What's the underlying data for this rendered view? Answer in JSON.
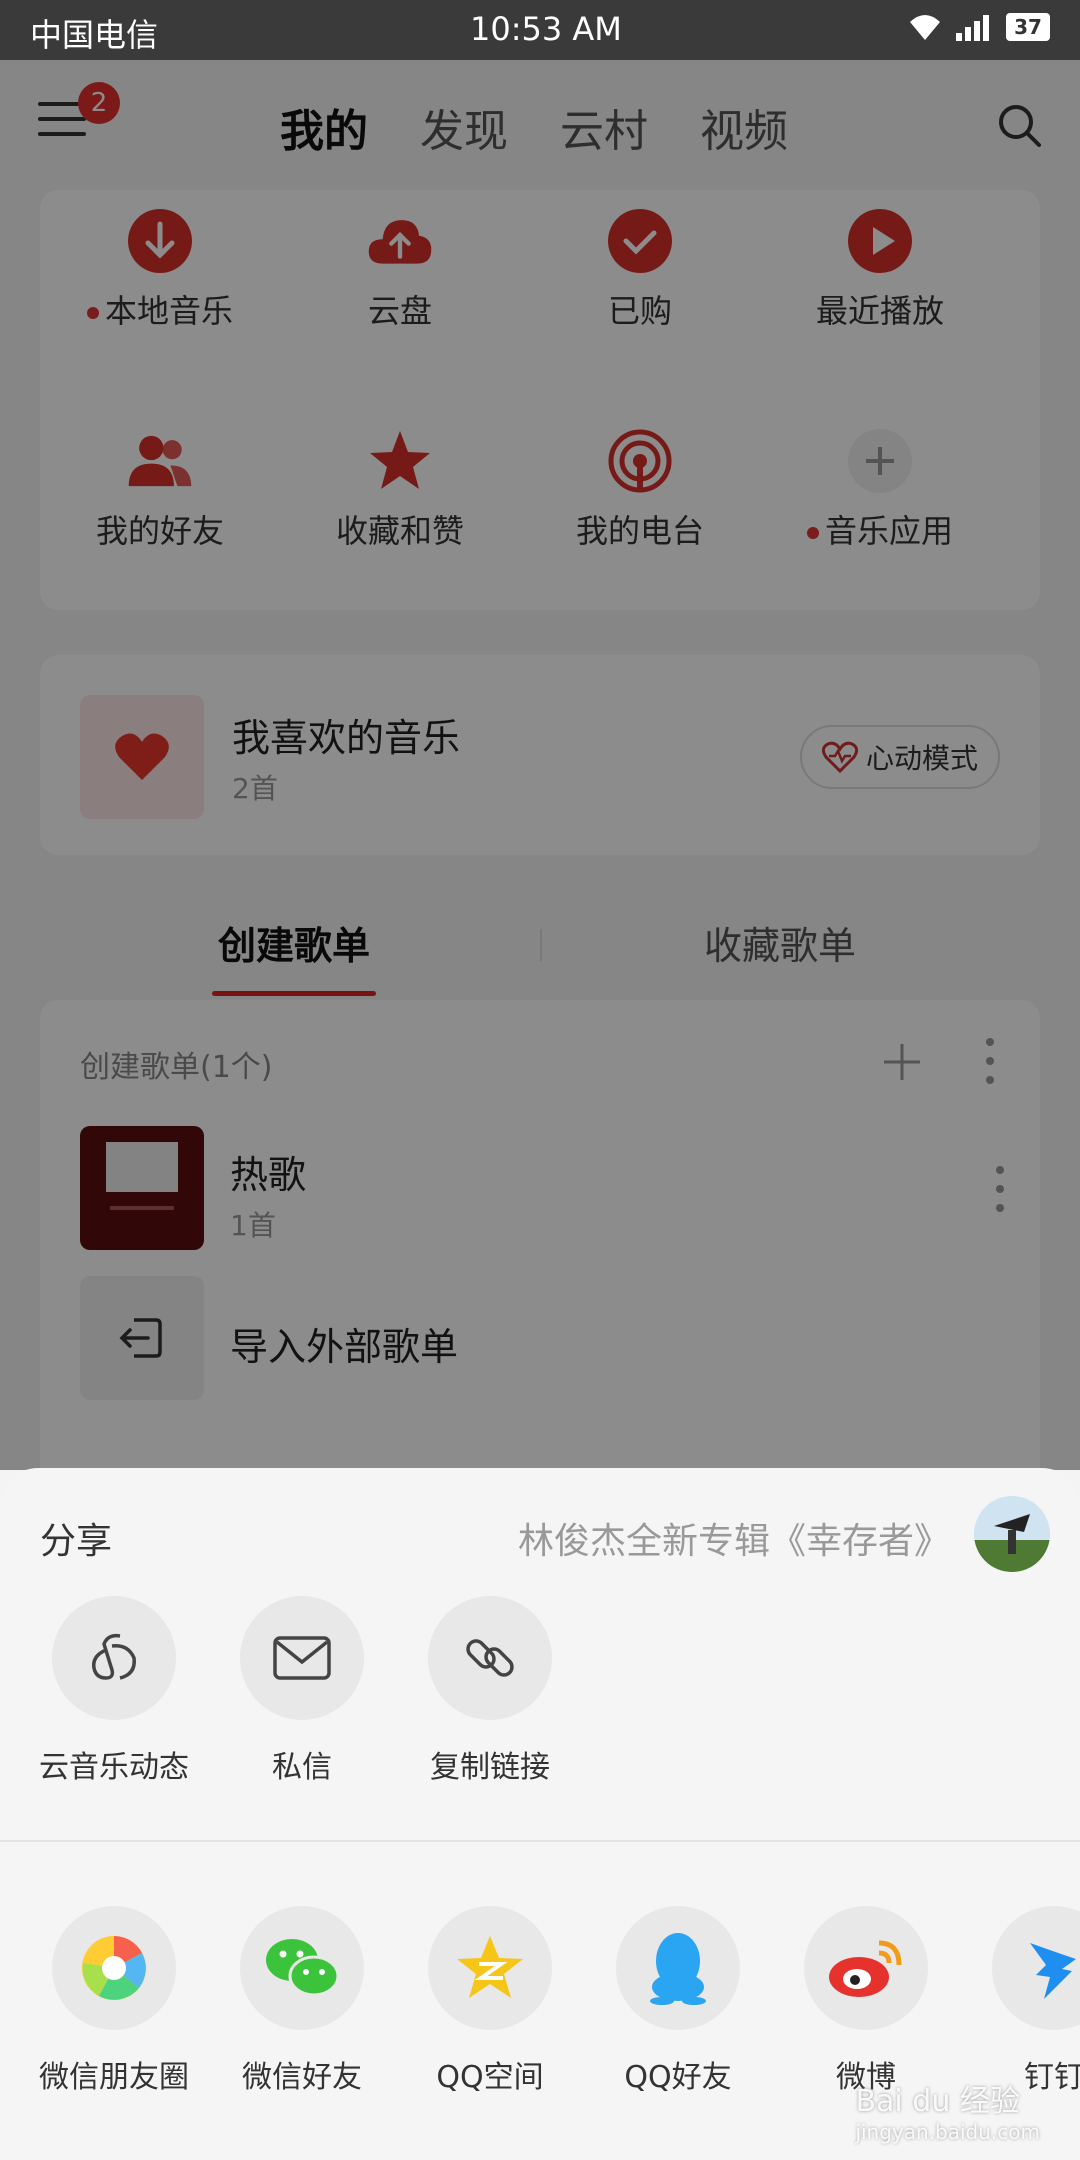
{
  "status_bar": {
    "carrier": "中国电信",
    "time": "10:53 AM",
    "battery": "37"
  },
  "header": {
    "badge_count": "2",
    "tabs": [
      "我的",
      "发现",
      "云村",
      "视频"
    ]
  },
  "quick_grid": [
    {
      "label": "本地音乐",
      "icon": "download-icon",
      "dot": true
    },
    {
      "label": "云盘",
      "icon": "cloud-upload-icon",
      "dot": false
    },
    {
      "label": "已购",
      "icon": "check-icon",
      "dot": false
    },
    {
      "label": "最近播放",
      "icon": "play-icon",
      "dot": false
    },
    {
      "label": "我的好友",
      "icon": "friends-icon",
      "dot": false
    },
    {
      "label": "收藏和赞",
      "icon": "star-icon",
      "dot": false
    },
    {
      "label": "我的电台",
      "icon": "radio-icon",
      "dot": false
    },
    {
      "label": "音乐应用",
      "icon": "plus-icon",
      "dot": true
    }
  ],
  "favorites": {
    "title": "我喜欢的音乐",
    "count": "2首",
    "mode_label": "心动模式"
  },
  "playlist_tabs": {
    "created": "创建歌单",
    "collected": "收藏歌单"
  },
  "playlists": {
    "header": "创建歌单(1个)",
    "items": [
      {
        "name": "热歌",
        "count": "1首"
      }
    ],
    "import_label": "导入外部歌单"
  },
  "share_sheet": {
    "title": "分享",
    "song": "林俊杰全新专辑《幸存者》",
    "internal": [
      {
        "label": "云音乐动态",
        "icon": "cloud-music-icon"
      },
      {
        "label": "私信",
        "icon": "mail-icon"
      },
      {
        "label": "复制链接",
        "icon": "link-icon"
      }
    ],
    "external": [
      {
        "label": "微信朋友圈",
        "icon": "wechat-moments-icon"
      },
      {
        "label": "微信好友",
        "icon": "wechat-icon"
      },
      {
        "label": "QQ空间",
        "icon": "qzone-icon"
      },
      {
        "label": "QQ好友",
        "icon": "qq-icon"
      },
      {
        "label": "微博",
        "icon": "weibo-icon"
      },
      {
        "label": "钉钉",
        "icon": "dingtalk-icon"
      }
    ]
  },
  "watermark": {
    "brand": "Bai du 经验",
    "url": "jingyan.baidu.com"
  },
  "colors": {
    "accent": "#d8312b",
    "dim_overlay": "rgba(0,0,0,0.45)"
  }
}
